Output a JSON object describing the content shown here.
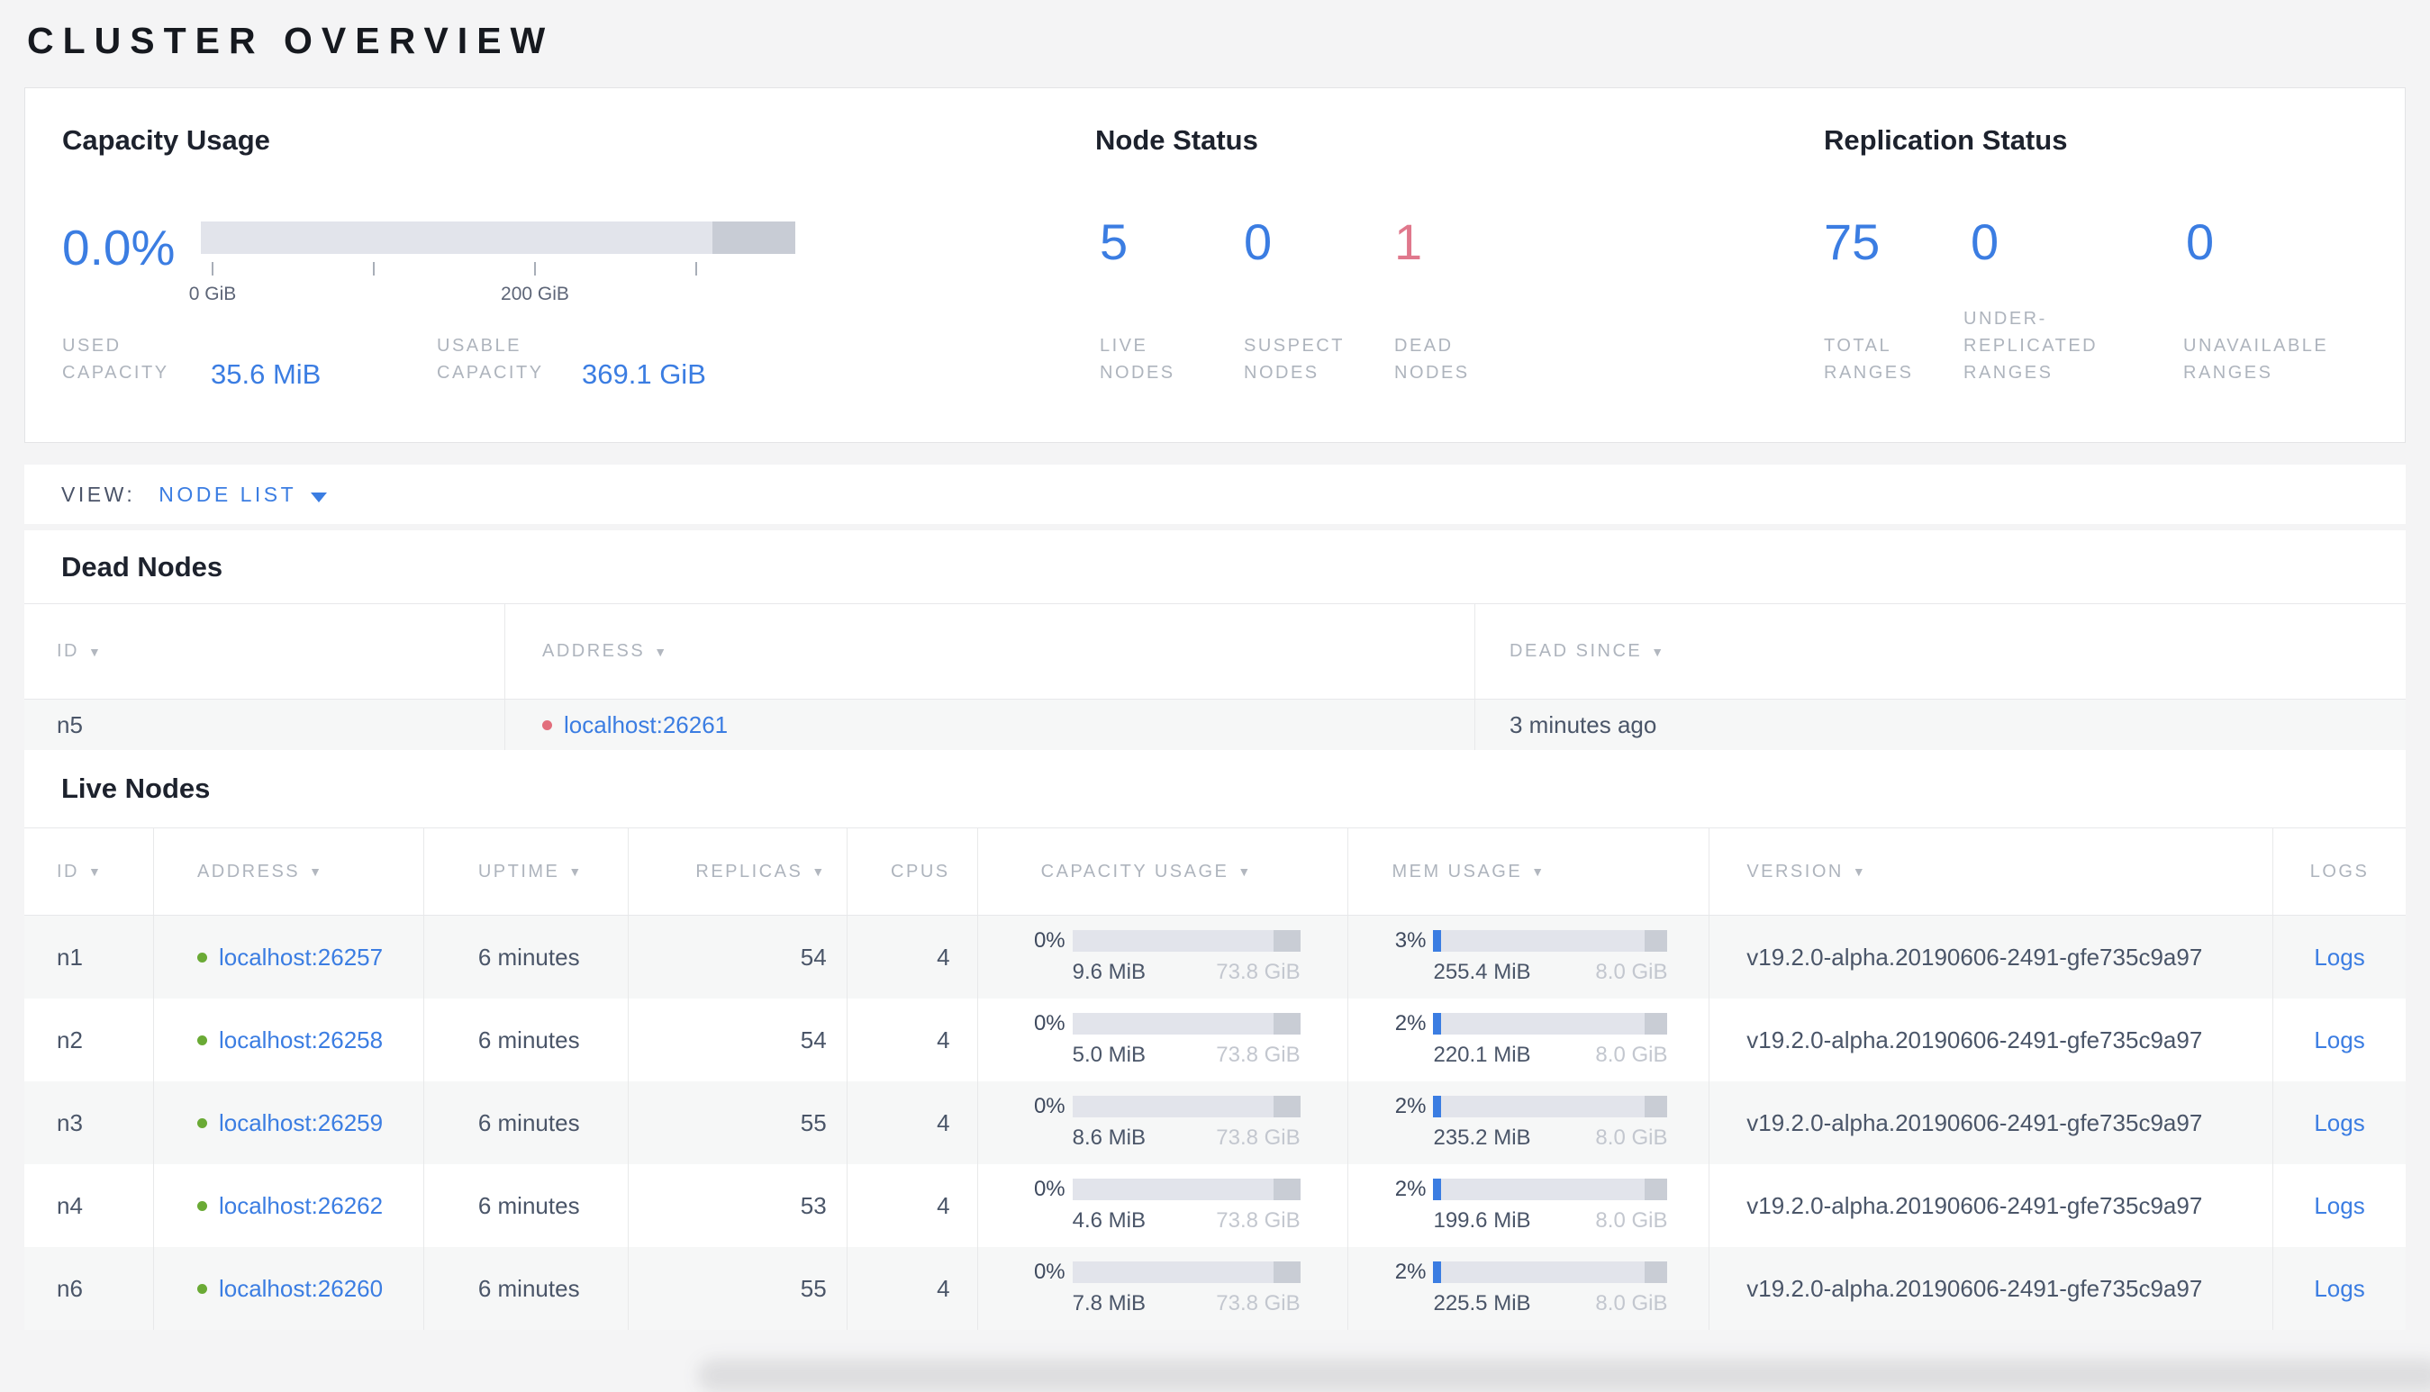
{
  "page": {
    "title": "CLUSTER OVERVIEW"
  },
  "icons": {
    "sort_desc": "▼"
  },
  "colors": {
    "accent_blue": "#3b7de2",
    "danger_red": "#e0788c",
    "live_dot_green": "#6aaa35",
    "dead_dot_red": "#e26e7c"
  },
  "summary": {
    "capacity": {
      "title": "Capacity Usage",
      "percent": "0.0%",
      "axis": {
        "tick_0": "0 GiB",
        "tick_200": "200 GiB"
      },
      "used": {
        "label": "USED CAPACITY",
        "value": "35.6 MiB"
      },
      "usable": {
        "label": "USABLE CAPACITY",
        "value": "369.1 GiB"
      }
    },
    "node_status": {
      "title": "Node Status",
      "live": {
        "value": "5",
        "label": "LIVE NODES"
      },
      "suspect": {
        "value": "0",
        "label": "SUSPECT NODES"
      },
      "dead": {
        "value": "1",
        "label": "DEAD NODES"
      }
    },
    "replication": {
      "title": "Replication Status",
      "total": {
        "value": "75",
        "label": "TOTAL RANGES"
      },
      "under_replicated": {
        "value": "0",
        "label": "UNDER-REPLICATED RANGES"
      },
      "unavailable": {
        "value": "0",
        "label": "UNAVAILABLE RANGES"
      }
    }
  },
  "view_bar": {
    "label": "VIEW:",
    "value": "NODE LIST"
  },
  "dead_nodes": {
    "title": "Dead Nodes",
    "columns": {
      "id": "ID",
      "address": "ADDRESS",
      "dead_since": "DEAD SINCE"
    },
    "row": {
      "id": "n5",
      "address": "localhost:26261",
      "dead_since": "3 minutes ago"
    }
  },
  "live_nodes": {
    "title": "Live Nodes",
    "columns": {
      "id": "ID",
      "address": "ADDRESS",
      "uptime": "UPTIME",
      "replicas": "REPLICAS",
      "cpus": "CPUS",
      "capacity": "CAPACITY USAGE",
      "mem": "MEM USAGE",
      "version": "VERSION",
      "logs": "LOGS"
    },
    "rows": [
      {
        "id": "n1",
        "address": "localhost:26257",
        "uptime": "6 minutes",
        "replicas": "54",
        "cpus": "4",
        "cap_pct": "0%",
        "cap_used": "9.6 MiB",
        "cap_total": "73.8 GiB",
        "mem_pct": "3%",
        "mem_used": "255.4 MiB",
        "mem_total": "8.0 GiB",
        "version": "v19.2.0-alpha.20190606-2491-gfe735c9a97",
        "logs": "Logs"
      },
      {
        "id": "n2",
        "address": "localhost:26258",
        "uptime": "6 minutes",
        "replicas": "54",
        "cpus": "4",
        "cap_pct": "0%",
        "cap_used": "5.0 MiB",
        "cap_total": "73.8 GiB",
        "mem_pct": "2%",
        "mem_used": "220.1 MiB",
        "mem_total": "8.0 GiB",
        "version": "v19.2.0-alpha.20190606-2491-gfe735c9a97",
        "logs": "Logs"
      },
      {
        "id": "n3",
        "address": "localhost:26259",
        "uptime": "6 minutes",
        "replicas": "55",
        "cpus": "4",
        "cap_pct": "0%",
        "cap_used": "8.6 MiB",
        "cap_total": "73.8 GiB",
        "mem_pct": "2%",
        "mem_used": "235.2 MiB",
        "mem_total": "8.0 GiB",
        "version": "v19.2.0-alpha.20190606-2491-gfe735c9a97",
        "logs": "Logs"
      },
      {
        "id": "n4",
        "address": "localhost:26262",
        "uptime": "6 minutes",
        "replicas": "53",
        "cpus": "4",
        "cap_pct": "0%",
        "cap_used": "4.6 MiB",
        "cap_total": "73.8 GiB",
        "mem_pct": "2%",
        "mem_used": "199.6 MiB",
        "mem_total": "8.0 GiB",
        "version": "v19.2.0-alpha.20190606-2491-gfe735c9a97",
        "logs": "Logs"
      },
      {
        "id": "n6",
        "address": "localhost:26260",
        "uptime": "6 minutes",
        "replicas": "55",
        "cpus": "4",
        "cap_pct": "0%",
        "cap_used": "7.8 MiB",
        "cap_total": "73.8 GiB",
        "mem_pct": "2%",
        "mem_used": "225.5 MiB",
        "mem_total": "8.0 GiB",
        "version": "v19.2.0-alpha.20190606-2491-gfe735c9a97",
        "logs": "Logs"
      }
    ]
  }
}
